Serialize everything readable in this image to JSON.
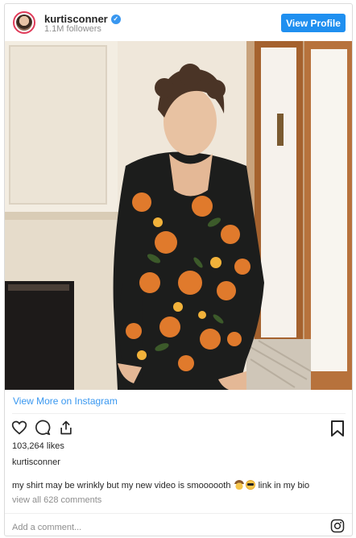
{
  "header": {
    "username": "kurtisconner",
    "followers": "1.1M followers",
    "view_profile_label": "View Profile"
  },
  "post": {
    "view_more_label": "View More on Instagram",
    "likes": "103,264 likes",
    "caption_user": "kurtisconner",
    "caption_text_before": "my shirt may be wrinkly but my new video is smoooooth",
    "caption_text_after": "link in my bio",
    "comments_link": "view all 628 comments",
    "add_comment_placeholder": "Add a comment..."
  },
  "icons": {
    "like": "heart-icon",
    "comment": "comment-icon",
    "share": "share-icon",
    "save": "bookmark-icon",
    "instagram": "instagram-icon",
    "verified": "verified-badge-icon",
    "emojis": [
      "cowboy-face-emoji",
      "sunglasses-face-emoji"
    ]
  },
  "colors": {
    "accent": "#1f8ff0",
    "link": "#3897f0",
    "muted": "#8e8e8e",
    "text": "#262626",
    "border": "#dbdbdb"
  }
}
